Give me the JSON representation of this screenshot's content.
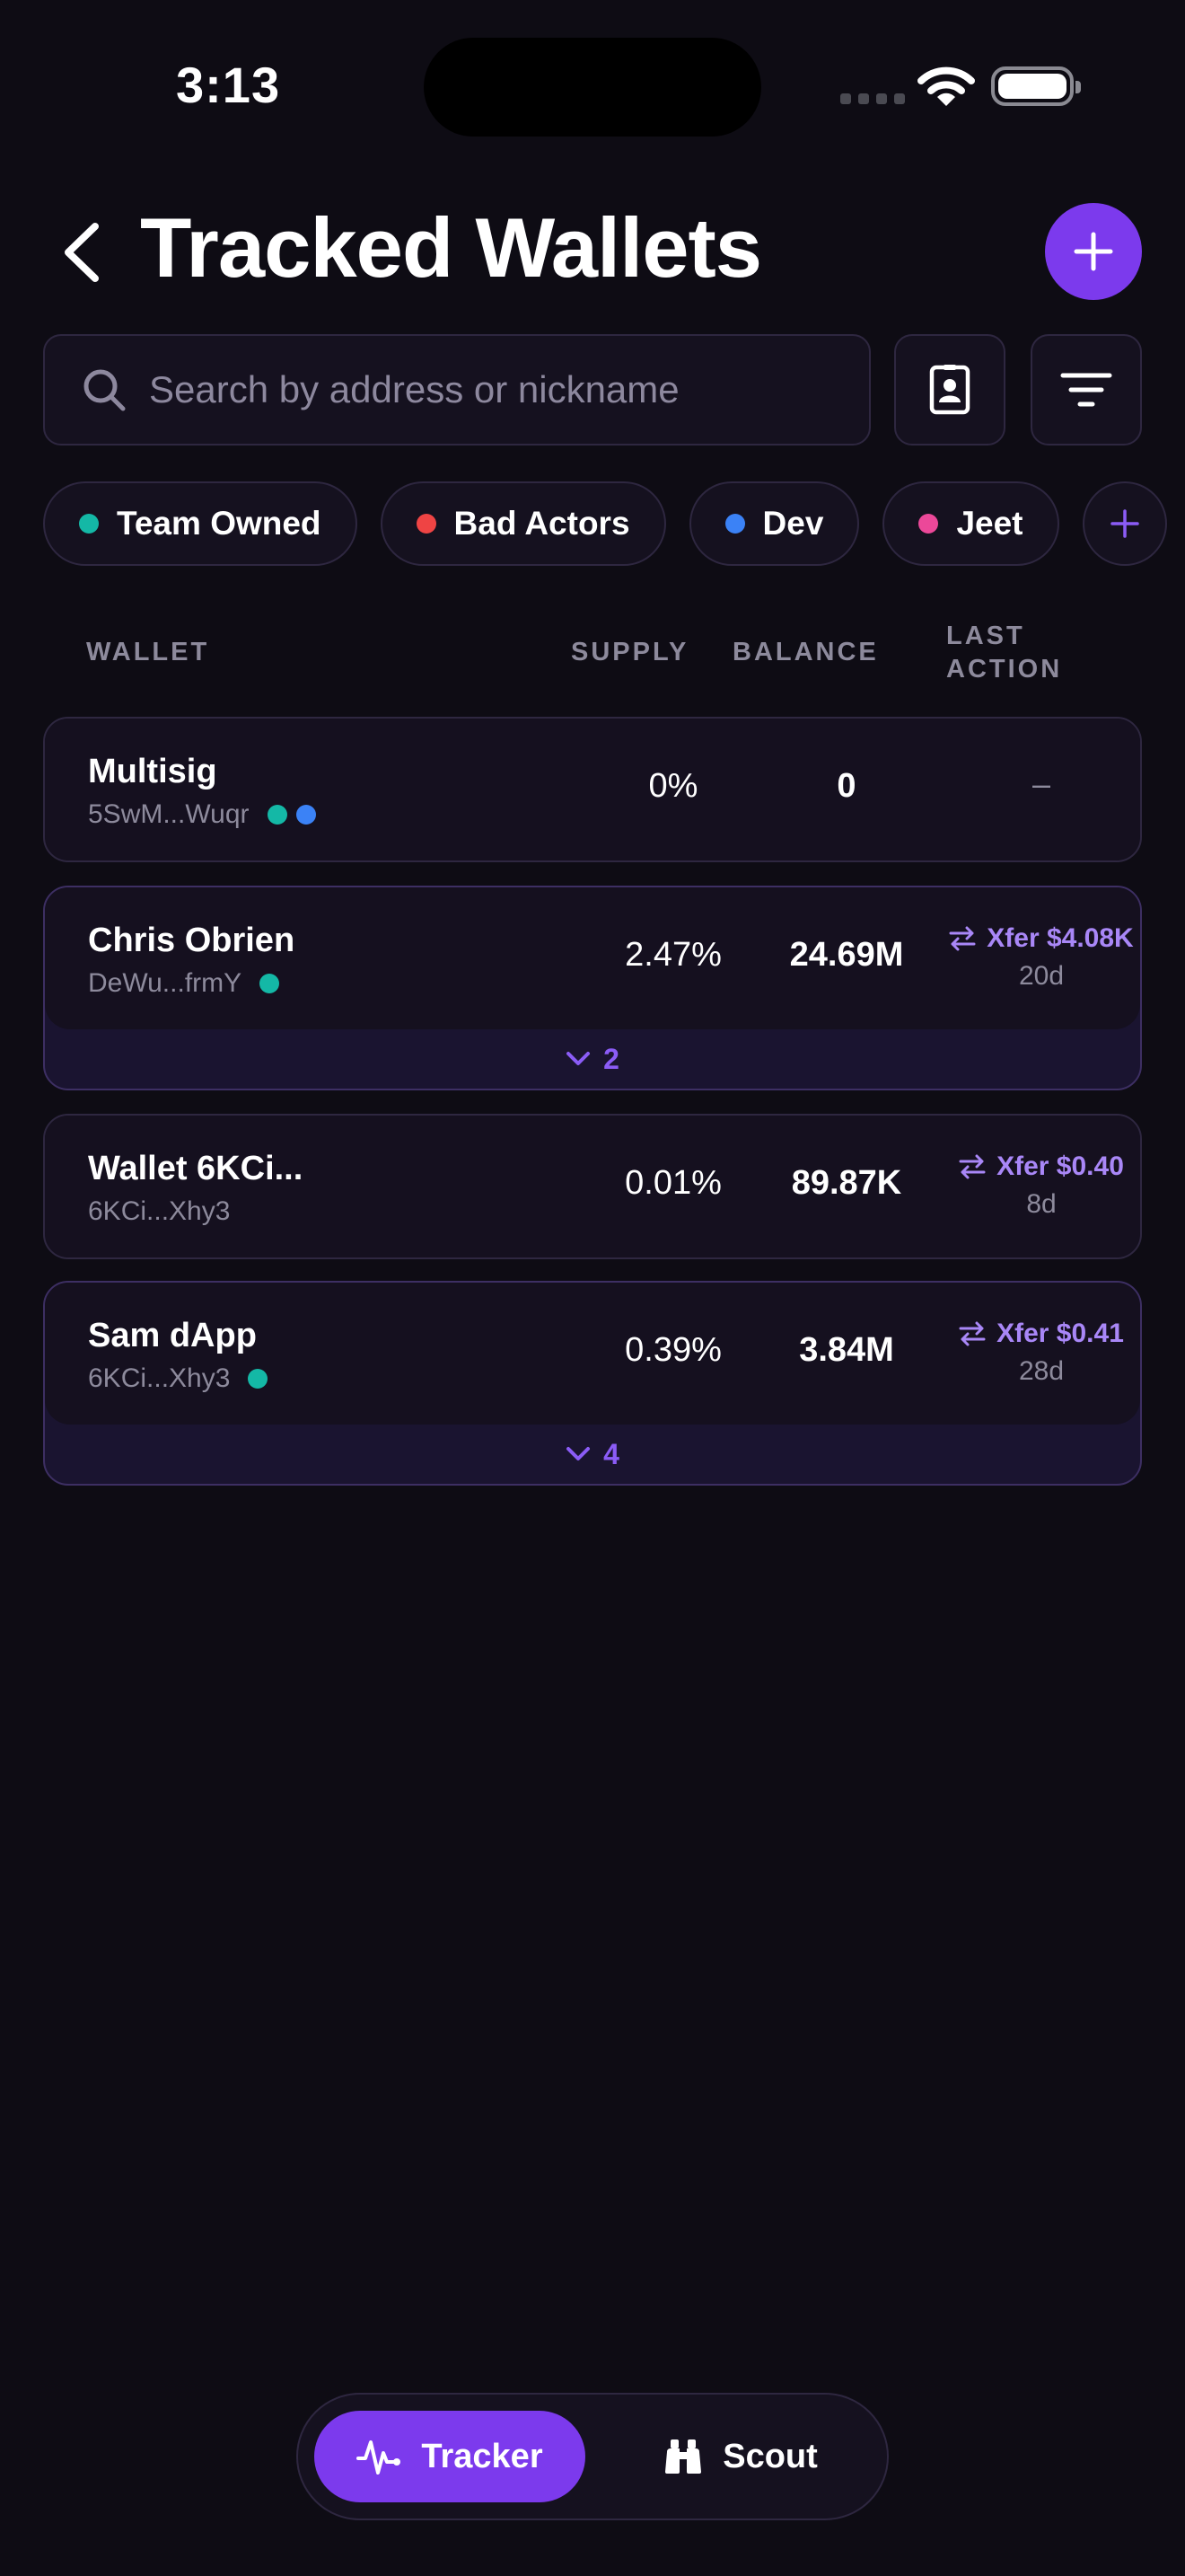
{
  "status_bar": {
    "time": "3:13"
  },
  "header": {
    "title": "Tracked Wallets"
  },
  "search": {
    "placeholder": "Search by address or nickname"
  },
  "chips": [
    {
      "label": "Team Owned",
      "color": "#14b8a6"
    },
    {
      "label": "Bad Actors",
      "color": "#ef4444"
    },
    {
      "label": "Dev",
      "color": "#3b82f6"
    },
    {
      "label": "Jeet",
      "color": "#ec4899"
    }
  ],
  "table_header": {
    "wallet": "WALLET",
    "supply": "SUPPLY",
    "balance": "BALANCE",
    "last_action_1": "LAST",
    "last_action_2": "ACTION"
  },
  "rows": [
    {
      "name": "Multisig",
      "address": "5SwM...Wuqr",
      "tags": [
        "#14b8a6",
        "#3b82f6"
      ],
      "supply": "0%",
      "balance": "0",
      "last_action": "–",
      "last_ago": "",
      "expand_count": ""
    },
    {
      "name": "Chris Obrien",
      "address": "DeWu...frmY",
      "tags": [
        "#14b8a6"
      ],
      "supply": "2.47%",
      "balance": "24.69M",
      "last_action": "Xfer $4.08K",
      "last_ago": "20d",
      "expand_count": "2"
    },
    {
      "name": "Wallet 6KCi...",
      "address": "6KCi...Xhy3",
      "tags": [],
      "supply": "0.01%",
      "balance": "89.87K",
      "last_action": "Xfer $0.40",
      "last_ago": "8d",
      "expand_count": ""
    },
    {
      "name": "Sam dApp",
      "address": "6KCi...Xhy3",
      "tags": [
        "#14b8a6"
      ],
      "supply": "0.39%",
      "balance": "3.84M",
      "last_action": "Xfer $0.41",
      "last_ago": "28d",
      "expand_count": "4"
    }
  ],
  "tabbar": {
    "tracker": "Tracker",
    "scout": "Scout"
  },
  "colors": {
    "accent": "#7c3aed",
    "accent_text": "#a987f7",
    "background": "#0e0c14"
  }
}
